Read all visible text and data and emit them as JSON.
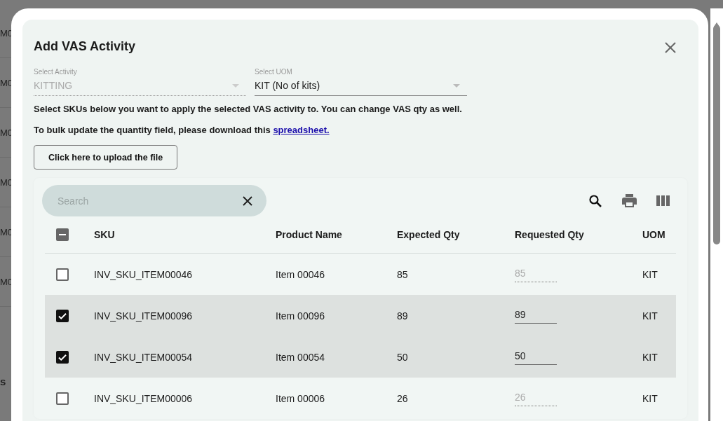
{
  "background_page": {
    "left_cells": [
      "M0",
      "M0",
      "M0",
      "M0",
      "M0",
      "M0"
    ],
    "bottom_left_text": "s"
  },
  "dialog": {
    "title": "Add VAS Activity",
    "activity_select": {
      "label": "Select Activity",
      "value": "KITTING",
      "disabled": true
    },
    "uom_select": {
      "label": "Select UOM",
      "value": "KIT (No of kits)",
      "disabled": false
    },
    "instructions": "Select SKUs below you want to apply the selected VAS activity to. You can change VAS qty as well.",
    "bulk_text": "To bulk update the quantity field, please download this ",
    "bulk_link": "spreadsheet.",
    "upload_button": "Click here to upload the file",
    "table": {
      "search": {
        "placeholder": "Search"
      },
      "select_all_partial": true,
      "columns": [
        "SKU",
        "Product Name",
        "Expected Qty",
        "Requested Qty",
        "UOM"
      ],
      "rows": [
        {
          "selected": false,
          "sku": "INV_SKU_ITEM00046",
          "product": "Item 00046",
          "expected": "85",
          "requested": "85",
          "uom": "KIT"
        },
        {
          "selected": true,
          "sku": "INV_SKU_ITEM00096",
          "product": "Item 00096",
          "expected": "89",
          "requested": "89",
          "uom": "KIT"
        },
        {
          "selected": true,
          "sku": "INV_SKU_ITEM00054",
          "product": "Item 00054",
          "expected": "50",
          "requested": "50",
          "uom": "KIT"
        },
        {
          "selected": false,
          "sku": "INV_SKU_ITEM00006",
          "product": "Item 00006",
          "expected": "26",
          "requested": "26",
          "uom": "KIT"
        }
      ]
    }
  }
}
